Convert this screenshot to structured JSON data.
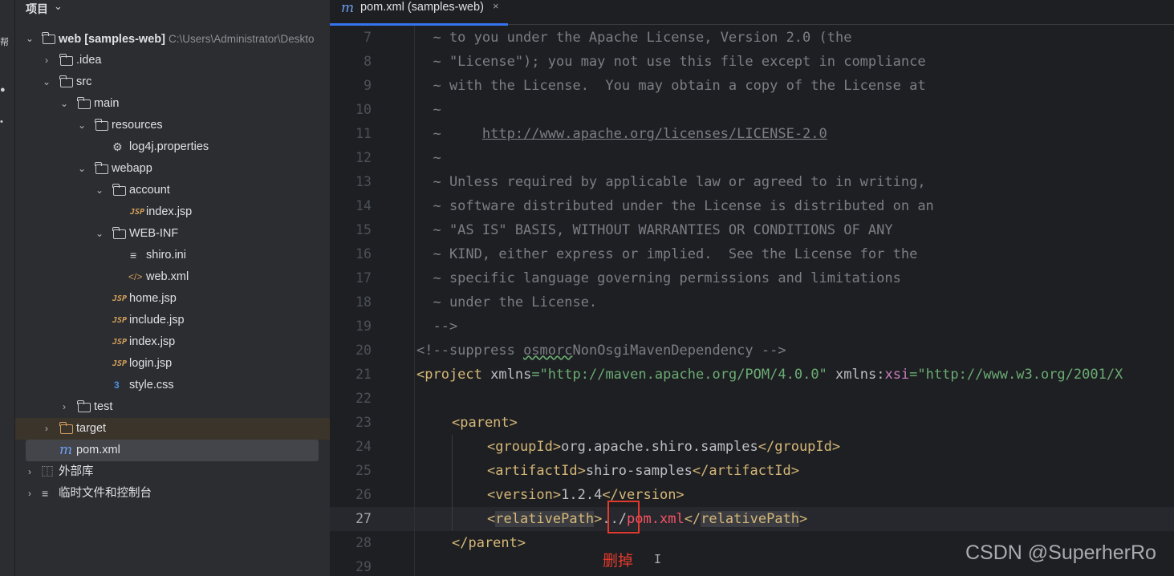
{
  "left_strip": {
    "glyphs": [
      "≡",
      "帮",
      "●",
      "•"
    ]
  },
  "project_panel": {
    "title": "项目",
    "root_label": "web [samples-web]",
    "root_path": "C:\\Users\\Administrator\\Deskto",
    "items": [
      {
        "label": ".idea"
      },
      {
        "label": "src"
      },
      {
        "label": "main"
      },
      {
        "label": "resources"
      },
      {
        "label": "log4j.properties"
      },
      {
        "label": "webapp"
      },
      {
        "label": "account"
      },
      {
        "label": "index.jsp"
      },
      {
        "label": "WEB-INF"
      },
      {
        "label": "shiro.ini"
      },
      {
        "label": "web.xml"
      },
      {
        "label": "home.jsp"
      },
      {
        "label": "include.jsp"
      },
      {
        "label": "index.jsp"
      },
      {
        "label": "login.jsp"
      },
      {
        "label": "style.css"
      },
      {
        "label": "test"
      },
      {
        "label": "target"
      },
      {
        "label": "pom.xml"
      },
      {
        "label": "外部库"
      },
      {
        "label": "临时文件和控制台"
      }
    ],
    "icons": {
      "jsp": "JSP",
      "css": "3",
      "gear": "⚙",
      "lines": "≡",
      "xml": "</>",
      "maven": "m",
      "libs": "⿰"
    }
  },
  "editor": {
    "tab": {
      "label": "pom.xml (samples-web)",
      "icon": "m",
      "close": "×"
    },
    "line_numbers": [
      "7",
      "8",
      "9",
      "10",
      "11",
      "12",
      "13",
      "14",
      "15",
      "16",
      "17",
      "18",
      "19",
      "20",
      "21",
      "22",
      "23",
      "24",
      "25",
      "26",
      "27",
      "28",
      "29"
    ],
    "lines": {
      "l7": "  ~ to you under the Apache License, Version 2.0 (the",
      "l8": "  ~ \"License\"); you may not use this file except in compliance",
      "l9": "  ~ with the License.  You may obtain a copy of the License at",
      "l10": "  ~",
      "l11_pre": "  ~     ",
      "l11_link": "http://www.apache.org/licenses/LICENSE-2.0",
      "l12": "  ~",
      "l13": "  ~ Unless required by applicable law or agreed to in writing,",
      "l14": "  ~ software distributed under the License is distributed on an",
      "l15": "  ~ \"AS IS\" BASIS, WITHOUT WARRANTIES OR CONDITIONS OF ANY",
      "l16": "  ~ KIND, either express or implied.  See the License for the",
      "l17": "  ~ specific language governing permissions and limitations",
      "l18": "  ~ under the License.",
      "l19": "  -->",
      "l20_a": "<!--suppress ",
      "l20_b": "osmorc",
      "l20_c": "NonOsgiMavenDependency -->",
      "l21_tag": "<project",
      "l21_attr1": " xmlns",
      "l21_eq1": "=",
      "l21_val1": "\"http://maven.apache.org/POM/4.0.0\"",
      "l21_attr2": " xmlns:",
      "l21_ns": "xsi",
      "l21_eq2": "=",
      "l21_val2": "\"http://www.w3.org/2001/X",
      "l23_open": "<parent>",
      "l24_open": "<groupId>",
      "l24_text": "org.apache.shiro.samples",
      "l24_close": "</groupId>",
      "l25_open": "<artifactId>",
      "l25_text": "shiro-samples",
      "l25_close": "</artifactId>",
      "l26_open": "<version>",
      "l26_text": "1.2.4",
      "l26_close": "</version>",
      "l27_open_a": "<",
      "l27_open_name": "relativePath",
      "l27_open_b": ">",
      "l27_dots": "../",
      "l27_file": "pom.xml",
      "l27_close_a": "</",
      "l27_close_name": "relativePath",
      "l27_close_b": ">",
      "l28_close": "</parent>"
    }
  },
  "annotation": {
    "delete_note": "删掉",
    "highlight_color": "#e23a2e"
  },
  "cursor_glyph": "I",
  "watermark": "CSDN @SuperherRo"
}
